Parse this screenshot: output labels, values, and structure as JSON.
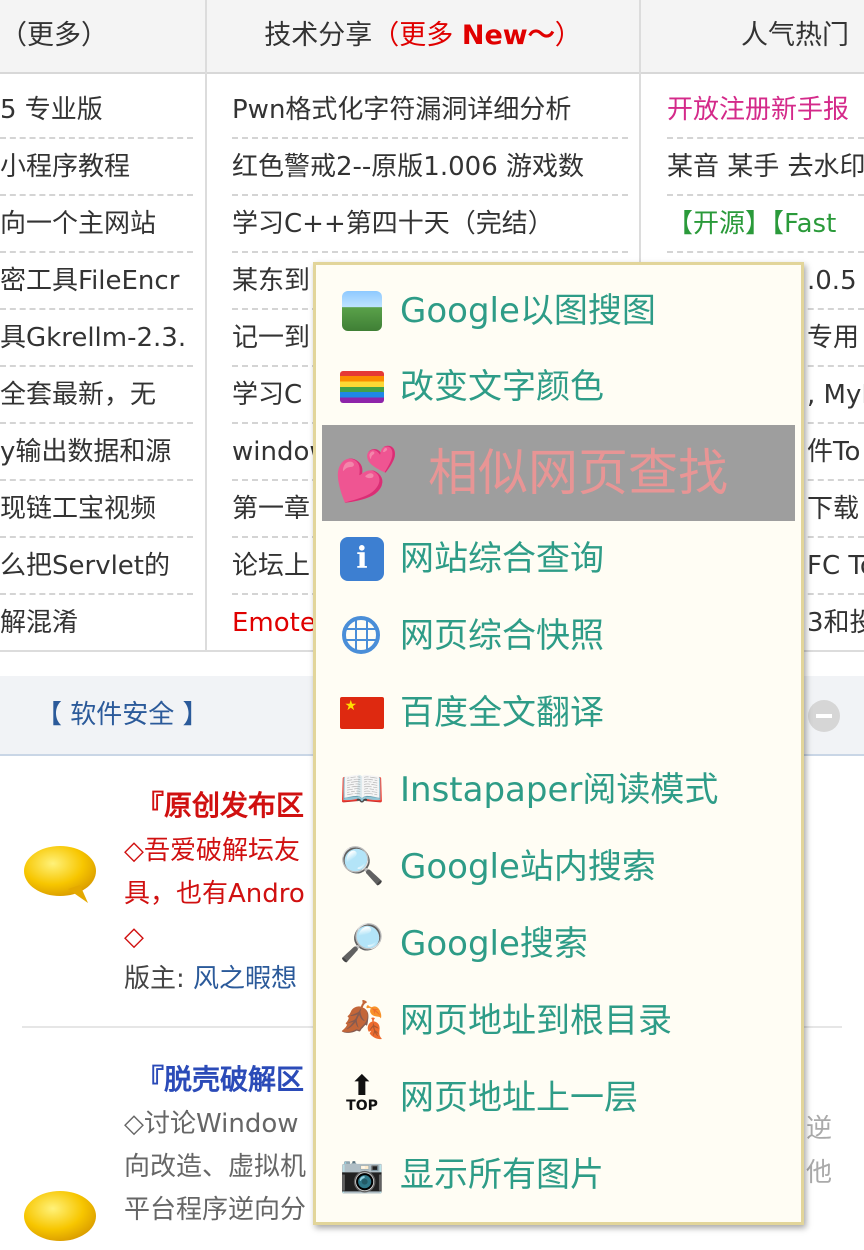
{
  "tabs": {
    "tab1": "（更多）",
    "tab2_prefix": "技术分享",
    "tab2_more_open": "（更多 ",
    "tab2_new": "New～",
    "tab2_more_close": "）",
    "tab3": "人气热门"
  },
  "col1": [
    "5 专业版",
    "小程序教程",
    "向一个主网站",
    "密工具FileEncr",
    "具Gkrellm-2.3.",
    "全套最新，无",
    "y输出数据和源",
    "现链工宝视频",
    "么把Servlet的",
    "解混淆"
  ],
  "col2": [
    "Pwn格式化字符漏洞详细分析",
    "红色警戒2--原版1.006 游戏数",
    "学习C++第四十天（完结）",
    "某东到",
    "记一到",
    "学习C",
    "window",
    "第一章",
    "论坛上",
    "Emote"
  ],
  "col3": {
    "rows": [
      "开放注册新手报",
      "某音 某手 去水印",
      "",
      ".0.5",
      "专用",
      ", MyF",
      "件To",
      "下载",
      "FC To",
      "3和投"
    ],
    "row3_a": "【开源】",
    "row3_b": "【Fast"
  },
  "section": {
    "title": "【 软件安全 】"
  },
  "forum1": {
    "title": "『原创发布区",
    "desc_lines": [
      "◇吾爱破解坛友",
      "具，也有Andro",
      "◇"
    ],
    "mods_label": "版主: ",
    "mods_link": "风之暇想"
  },
  "forum2": {
    "title": "『脱壳破解区",
    "desc_lines": [
      "◇讨论Window",
      "向改造、虚拟机",
      "平台程序逆向分"
    ],
    "right_frag": [
      "逆",
      "他"
    ]
  },
  "menu": {
    "items": [
      {
        "label": "Google以图搜图",
        "icon": "photo-icon"
      },
      {
        "label": "改变文字颜色",
        "icon": "rainbow-icon"
      },
      {
        "label": "相似网页查找",
        "icon": "hearts-icon"
      },
      {
        "label": "网站综合查询",
        "icon": "info-icon"
      },
      {
        "label": "网页综合快照",
        "icon": "globe-icon"
      },
      {
        "label": "百度全文翻译",
        "icon": "china-flag-icon"
      },
      {
        "label": "Instapaper阅读模式",
        "icon": "book-icon"
      },
      {
        "label": "Google站内搜索",
        "icon": "magnifier-icon"
      },
      {
        "label": "Google搜索",
        "icon": "magnifier-right-icon"
      },
      {
        "label": "网页地址到根目录",
        "icon": "leaves-icon"
      },
      {
        "label": "网页地址上一层",
        "icon": "top-icon"
      },
      {
        "label": "显示所有图片",
        "icon": "camera-icon"
      }
    ],
    "highlighted_index": 2
  },
  "colors": {
    "accent_green": "#2e9c87",
    "highlight_bg": "#9e9e9e",
    "red": "#e00000"
  }
}
